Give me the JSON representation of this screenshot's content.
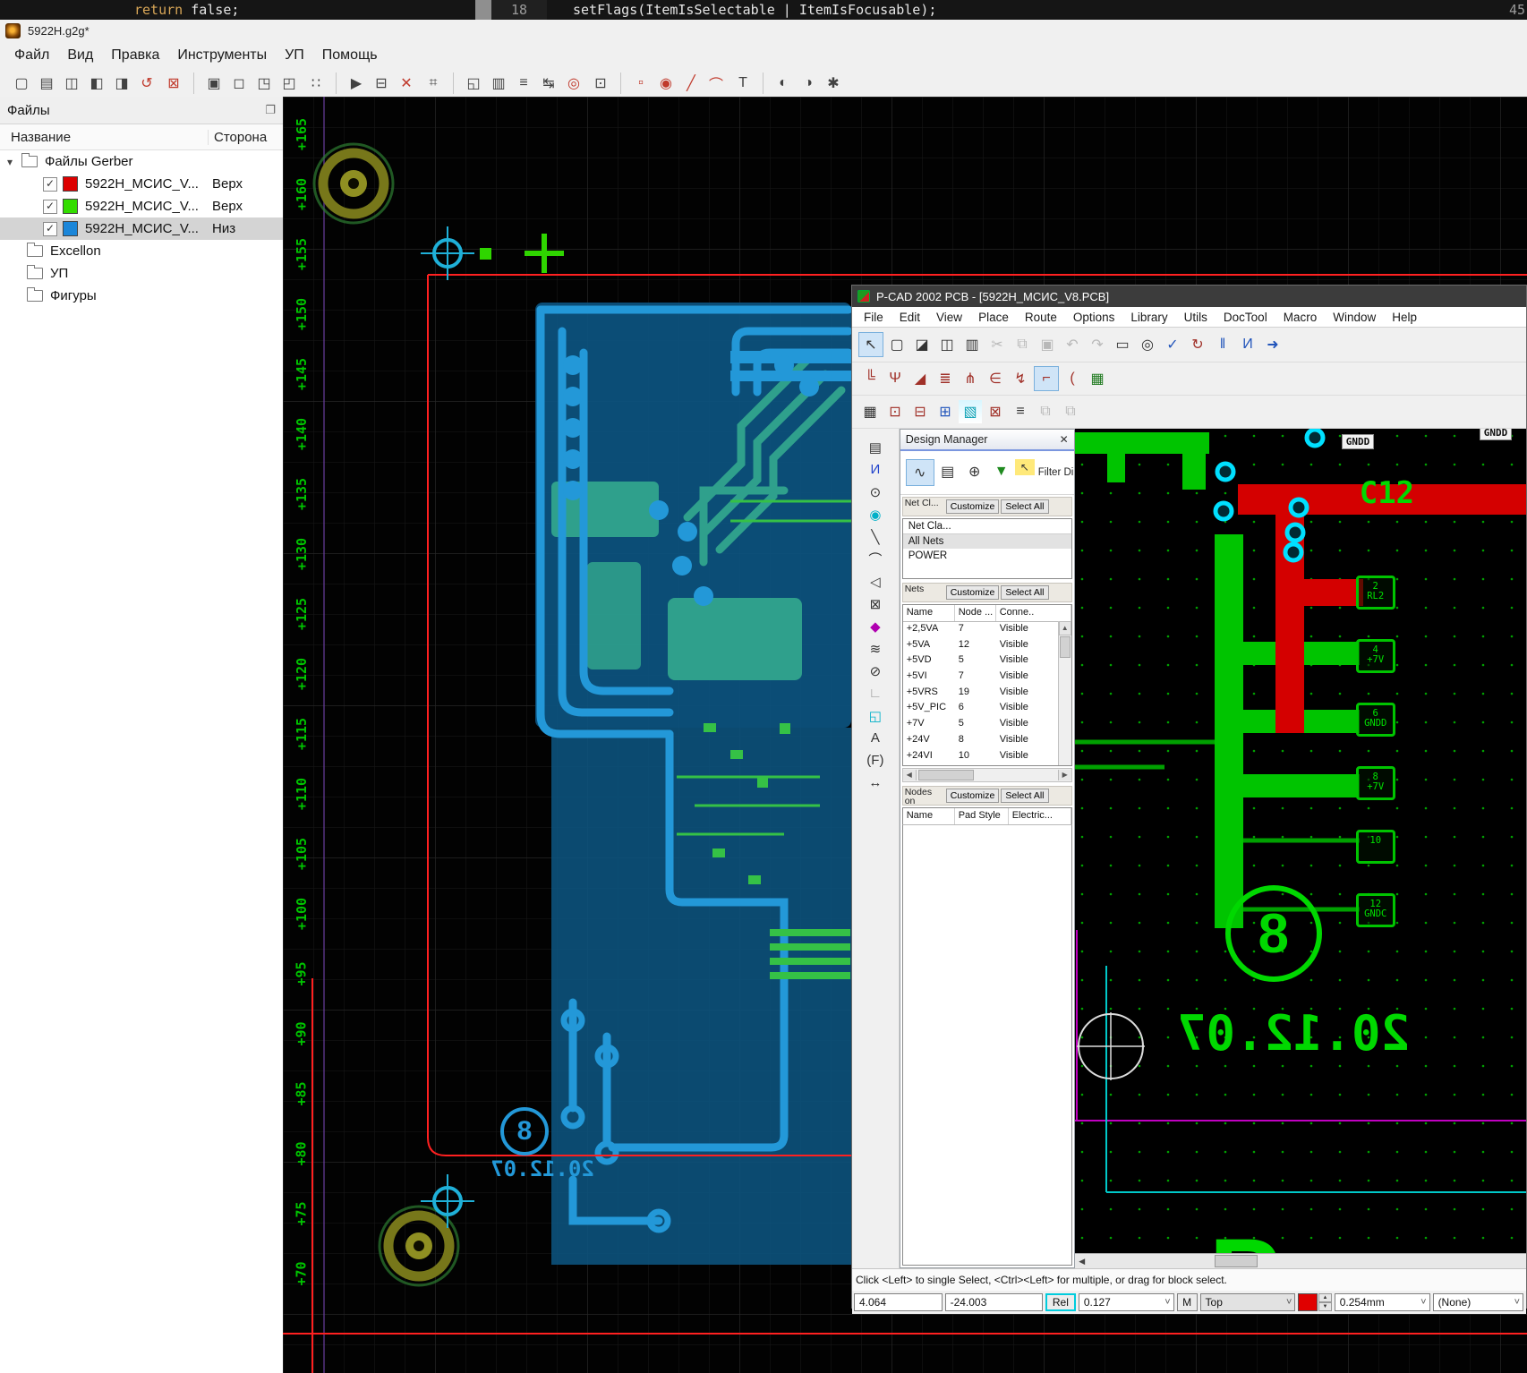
{
  "code_strip": {
    "left_keyword": "return",
    "left_rest": " false;",
    "line_number": "18",
    "right_code": "setFlags(ItemIsSelectable | ItemIsFocusable);",
    "right_margin_number": "45"
  },
  "gerber": {
    "title": "5922H.g2g*",
    "menus": [
      "Файл",
      "Вид",
      "Правка",
      "Инструменты",
      "УП",
      "Помощь"
    ],
    "toolbar": [
      {
        "name": "new-file-icon",
        "g": "▢"
      },
      {
        "name": "open-file-icon",
        "g": "▤"
      },
      {
        "name": "save-icon",
        "g": "◫"
      },
      {
        "name": "save-as-icon",
        "g": "◧"
      },
      {
        "name": "save-all-icon",
        "g": "◨"
      },
      {
        "name": "revert-icon",
        "g": "↺",
        "cls": "red"
      },
      {
        "name": "close-file-icon",
        "g": "⊠",
        "cls": "red sep-after"
      },
      {
        "name": "select-icon",
        "g": "▣"
      },
      {
        "name": "select-window-icon",
        "g": "◻"
      },
      {
        "name": "zoom-window-icon",
        "g": "◳"
      },
      {
        "name": "zoom-selection-icon",
        "g": "◰"
      },
      {
        "name": "tile-view-icon",
        "g": "∷",
        "cls": "sep-after"
      },
      {
        "name": "run-icon",
        "g": "▶"
      },
      {
        "name": "properties-icon",
        "g": "⊟"
      },
      {
        "name": "transform-icon",
        "g": "✕",
        "cls": "red"
      },
      {
        "name": "snap-grid-icon",
        "g": "⌗",
        "cls": "sep-after"
      },
      {
        "name": "layer-copy-icon",
        "g": "◱"
      },
      {
        "name": "layer-top-icon",
        "g": "▥"
      },
      {
        "name": "layer-list-icon",
        "g": "≡"
      },
      {
        "name": "swap-layers-icon",
        "g": "↹"
      },
      {
        "name": "flash-icon",
        "g": "◎",
        "cls": "red"
      },
      {
        "name": "frame-icon",
        "g": "⊡",
        "cls": "sep-after"
      },
      {
        "name": "pad-tool-icon",
        "g": "▫",
        "cls": "red"
      },
      {
        "name": "circle-tool-icon",
        "g": "◉",
        "cls": "red"
      },
      {
        "name": "line-tool-icon",
        "g": "╱",
        "cls": "red"
      },
      {
        "name": "arc-tool-icon",
        "g": "⌒",
        "cls": "red"
      },
      {
        "name": "text-tool-icon",
        "g": "T",
        "cls": "sep-after"
      },
      {
        "name": "group-icon",
        "g": "◐"
      },
      {
        "name": "ungroup-icon",
        "g": "◑"
      },
      {
        "name": "settings-icon",
        "g": "✱"
      }
    ],
    "files_panel": {
      "title": "Файлы",
      "col_name": "Название",
      "col_side": "Сторона",
      "root": "Файлы Gerber",
      "items": [
        {
          "label": "5922H_МСИС_V...",
          "side": "Верх",
          "swatch_css": "background:#dd0000"
        },
        {
          "label": "5922H_МСИС_V...",
          "side": "Верх",
          "swatch_css": "background:#33dd00"
        },
        {
          "label": "5922H_МСИС_V...",
          "side": "Низ",
          "swatch_css": "background:#1b86d9"
        }
      ],
      "check_glyph": "✓",
      "folders": [
        "Excellon",
        "УП",
        "Фигуры"
      ]
    },
    "ruler_labels": [
      "+165",
      "+160",
      "+155",
      "+150",
      "+145",
      "+140",
      "+135",
      "+130",
      "+125",
      "+120",
      "+115",
      "+110",
      "+105",
      "+100",
      "+95",
      "+90",
      "+85",
      "+80",
      "+75",
      "+70"
    ],
    "canvas_labels": {
      "big8": "8",
      "date": "20.12.07"
    }
  },
  "pcad": {
    "title": "P-CAD 2002 PCB - [5922H_МСИС_V8.PCB]",
    "menus": [
      "File",
      "Edit",
      "View",
      "Place",
      "Route",
      "Options",
      "Library",
      "Utils",
      "DocTool",
      "Macro",
      "Window",
      "Help"
    ],
    "toolbar1": [
      {
        "name": "select-tool",
        "g": "↖",
        "cls": "selected"
      },
      {
        "name": "new-doc-icon",
        "g": "▢"
      },
      {
        "name": "open-doc-icon",
        "g": "◪"
      },
      {
        "name": "save-doc-icon",
        "g": "◫"
      },
      {
        "name": "print-icon",
        "g": "▥"
      },
      {
        "name": "cut-icon",
        "g": "✂",
        "cls": "disabled"
      },
      {
        "name": "copy-icon",
        "g": "⧉",
        "cls": "disabled"
      },
      {
        "name": "paste-icon",
        "g": "▣",
        "cls": "disabled"
      },
      {
        "name": "undo-icon",
        "g": "↶",
        "cls": "disabled"
      },
      {
        "name": "redo-icon",
        "g": "↷",
        "cls": "disabled"
      },
      {
        "name": "measure-icon",
        "g": "▭"
      },
      {
        "name": "zoom-icon",
        "g": "◎"
      },
      {
        "name": "drc-icon",
        "g": "✓",
        "cls": "blue"
      },
      {
        "name": "refresh-icon",
        "g": "↻",
        "cls": "red"
      },
      {
        "name": "pause-icon",
        "g": "‖",
        "cls": "blue"
      },
      {
        "name": "intellisense-icon",
        "g": "И",
        "cls": "blue"
      },
      {
        "name": "exit-icon",
        "g": "➜",
        "cls": "blue"
      }
    ],
    "toolbar2": [
      {
        "name": "route-segment-icon",
        "g": "╚",
        "cls": "red"
      },
      {
        "name": "route-interactive-icon",
        "g": "Ψ",
        "cls": "red"
      },
      {
        "name": "route-miter-icon",
        "g": "◢",
        "cls": "red"
      },
      {
        "name": "route-fanout-icon",
        "g": "≣",
        "cls": "red"
      },
      {
        "name": "route-bus-icon",
        "g": "⋔",
        "cls": "red"
      },
      {
        "name": "route-multitrace-icon",
        "g": "∈",
        "cls": "red"
      },
      {
        "name": "push-route-icon",
        "g": "↯",
        "cls": "red"
      },
      {
        "name": "route-selected-icon",
        "g": "⌐",
        "cls": "red selected"
      },
      {
        "name": "route-arc-icon",
        "g": "(",
        "cls": "red"
      },
      {
        "name": "autoroute-icon",
        "g": "▦",
        "cls": "green"
      }
    ],
    "toolbar3": [
      {
        "name": "spreadsheet-icon",
        "g": "▦"
      },
      {
        "name": "module-icon",
        "g": "⊡",
        "cls": "red"
      },
      {
        "name": "module-alt-icon",
        "g": "⊟",
        "cls": "red"
      },
      {
        "name": "netlist-icon",
        "g": "⊞",
        "cls": "blue"
      },
      {
        "name": "image-icon",
        "g": "▧",
        "cls": "cyan"
      },
      {
        "name": "board-outline-icon",
        "g": "⊠",
        "cls": "red"
      },
      {
        "name": "list-view-icon",
        "g": "≡"
      },
      {
        "name": "paste-special-icon",
        "g": "⧉",
        "cls": "disabled"
      },
      {
        "name": "paste-special2-icon",
        "g": "⧉",
        "cls": "disabled"
      }
    ],
    "side_toolbar": [
      {
        "name": "place-component-icon",
        "g": "▤"
      },
      {
        "name": "place-connection-icon",
        "g": "И",
        "cls": "blue"
      },
      {
        "name": "place-pad-icon",
        "g": "⊙"
      },
      {
        "name": "place-via-icon",
        "g": "◉",
        "cls": "cyan"
      },
      {
        "name": "place-line-icon",
        "g": "╲"
      },
      {
        "name": "place-arc-icon",
        "g": "⌒"
      },
      {
        "name": "place-polygon-icon",
        "g": "◁"
      },
      {
        "name": "place-keepout-icon",
        "g": "⊠"
      },
      {
        "name": "place-fill-icon",
        "g": "◆",
        "cls": "mag"
      },
      {
        "name": "place-copper-pour-icon",
        "g": "≋"
      },
      {
        "name": "place-cutout-icon",
        "g": "⊘"
      },
      {
        "name": "place-room-icon",
        "g": "∟",
        "cls": "gray"
      },
      {
        "name": "select-area-icon",
        "g": "◱",
        "cls": "cyan"
      },
      {
        "name": "place-text-icon",
        "g": "A"
      },
      {
        "name": "place-field-icon",
        "g": "(F)"
      },
      {
        "name": "place-dimension-icon",
        "g": "↔"
      }
    ],
    "design_manager": {
      "title": "Design Manager",
      "close_glyph": "✕",
      "tools": [
        {
          "name": "nets-view-icon",
          "g": "∿",
          "cls": "sel"
        },
        {
          "name": "components-view-icon",
          "g": "▤"
        },
        {
          "name": "zoom-to-icon",
          "g": "⊕"
        },
        {
          "name": "filter-icon",
          "g": "▼",
          "cls": "green"
        },
        {
          "name": "pick-icon",
          "g": "↖",
          "cls": "yellow"
        }
      ],
      "filter_label": "Filter Dir",
      "net_section": {
        "title": "Net Cl...",
        "customize": "Customize",
        "select_all": "Select All",
        "column": "Net Cla...",
        "items": [
          "All Nets",
          "POWER"
        ]
      },
      "nets_section": {
        "title": "Nets",
        "customize": "Customize",
        "select_all": "Select All",
        "col_name": "Name",
        "col_nodes": "Node ...",
        "col_conn": "Conne..",
        "rows": [
          {
            "name2": "+2,5VA",
            "nodes": "7",
            "conn": "Visible"
          },
          {
            "name2": "+5VA",
            "nodes": "12",
            "conn": "Visible"
          },
          {
            "name2": "+5VD",
            "nodes": "5",
            "conn": "Visible"
          },
          {
            "name2": "+5VI",
            "nodes": "7",
            "conn": "Visible"
          },
          {
            "name2": "+5VRS",
            "nodes": "19",
            "conn": "Visible"
          },
          {
            "name2": "+5V_PIC",
            "nodes": "6",
            "conn": "Visible"
          },
          {
            "name2": "+7V",
            "nodes": "5",
            "conn": "Visible"
          },
          {
            "name2": "+24V",
            "nodes": "8",
            "conn": "Visible"
          },
          {
            "name2": "+24VI",
            "nodes": "10",
            "conn": "Visible"
          }
        ]
      },
      "nodes_section": {
        "title": "Nodes on",
        "customize": "Customize",
        "select_all": "Select All",
        "col_name": "Name",
        "col_pad": "Pad Style",
        "col_elec": "Electric..."
      }
    },
    "canvas": {
      "gndd1": "GNDD",
      "gndd2": "GNDD",
      "c12": "C12",
      "big8": "8",
      "date": "20.12.07",
      "partial_letter": "Р",
      "pads": [
        {
          "name": "pad-2-rl2",
          "pin": "2",
          "net": "RL2"
        },
        {
          "name": "pad-4-7v",
          "pin": "4",
          "net": "+7V"
        },
        {
          "name": "pad-6-gndd",
          "pin": "6",
          "net": "GNDD"
        },
        {
          "name": "pad-8-7v",
          "pin": "8",
          "net": "+7V"
        },
        {
          "name": "pad-10",
          "pin": "10",
          "net": ""
        },
        {
          "name": "pad-12-gndc",
          "pin": "12",
          "net": "GNDC"
        }
      ]
    },
    "status_message": "Click <Left> to single Select, <Ctrl><Left> for multiple, or drag for block select.",
    "status": {
      "x": "4.064",
      "y": "-24.003",
      "rel": "Rel",
      "grid": "0.127",
      "m": "M",
      "layer": "Top",
      "swatch_css": "background:#e00000",
      "width": "0.254mm",
      "pattern": "(None)"
    }
  },
  "colors": {
    "gerber_blue": "#2398d8",
    "gerber_teal": "#2fa08c",
    "gerber_green": "#35c146",
    "gerber_red": "#ff2020",
    "pcad_green": "#00c400",
    "pcad_red": "#d40000",
    "pcad_cyan": "#00e0ff",
    "magenta": "#c000c0"
  }
}
